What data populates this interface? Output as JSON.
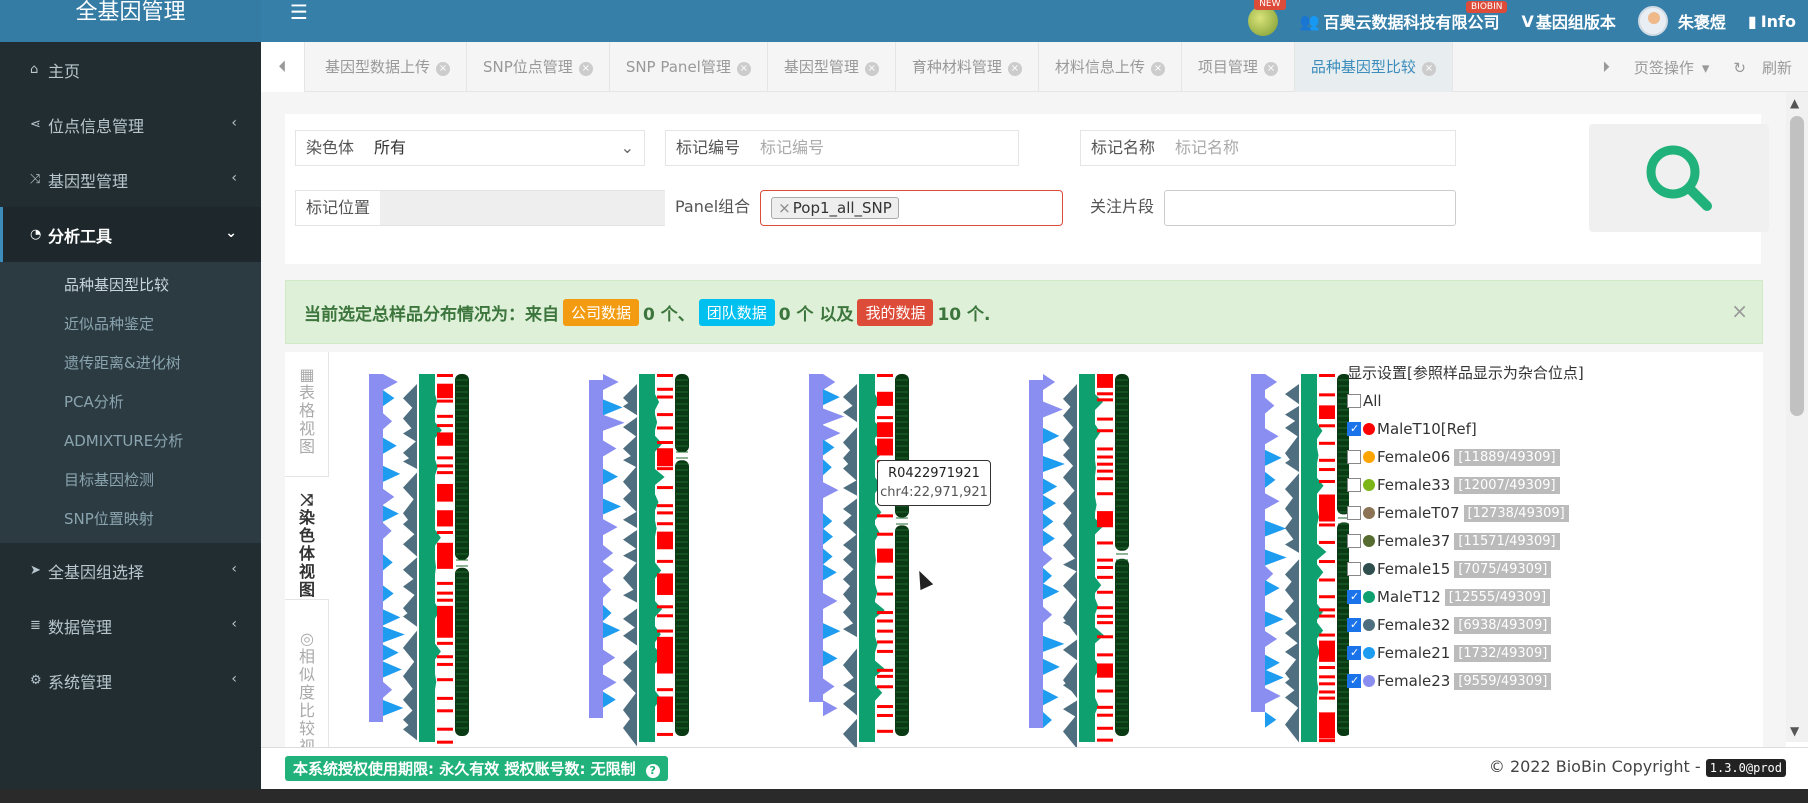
{
  "brand": {
    "title": "全基因管理"
  },
  "topbar": {
    "new_badge": "NEW",
    "company": "百奥云数据科技有限公司",
    "company_badge": "BIOBIN",
    "version": "基因组版本",
    "user": "朱褒煜",
    "info": "Info"
  },
  "sidebar": {
    "items": [
      {
        "label": "主页",
        "icon": "home-icon"
      },
      {
        "label": "位点信息管理",
        "icon": "share-icon"
      },
      {
        "label": "基因型管理",
        "icon": "random-icon"
      },
      {
        "label": "分析工具",
        "icon": "pie-chart-icon"
      },
      {
        "label": "全基因组选择",
        "icon": "paper-plane-icon"
      },
      {
        "label": "数据管理",
        "icon": "database-icon"
      },
      {
        "label": "系统管理",
        "icon": "gear-icon"
      }
    ],
    "analysis_sub": [
      "品种基因型比较",
      "近似品种鉴定",
      "遗传距离&进化树",
      "PCA分析",
      "ADMIXTURE分析",
      "目标基因检测",
      "SNP位置映射"
    ]
  },
  "tabs": {
    "items": [
      "基因型数据上传",
      "SNP位点管理",
      "SNP Panel管理",
      "基因型管理",
      "育种材料管理",
      "材料信息上传",
      "项目管理",
      "品种基因型比较"
    ],
    "page_ops": "页签操作",
    "refresh": "刷新"
  },
  "filters": {
    "chromosome_label": "染色体",
    "chromosome_value": "所有",
    "marker_id_label": "标记编号",
    "marker_id_placeholder": "标记编号",
    "marker_name_label": "标记名称",
    "marker_name_placeholder": "标记名称",
    "marker_pos_label": "标记位置",
    "panel_label": "Panel组合",
    "panel_tag": "Pop1_all_SNP",
    "focus_label": "关注片段"
  },
  "alert": {
    "prefix": "当前选定总样品分布情况为：来自",
    "company_label": "公司数据",
    "company_count": "0 个、",
    "team_label": "团队数据",
    "team_count": "0 个 以及",
    "mine_label": "我的数据",
    "mine_count": "10 个."
  },
  "view_tabs": [
    {
      "label": "表格视图",
      "icon": "table-icon"
    },
    {
      "label": "染色体视图",
      "icon": "random-icon"
    },
    {
      "label": "相似度比较视图",
      "icon": "chrome-icon"
    }
  ],
  "legend": {
    "header": "显示设置[参照样品显示为杂合位点]",
    "all_label": "All",
    "samples": [
      {
        "name": "MaleT10[Ref]",
        "color": "#ff0000",
        "checked": true,
        "count": ""
      },
      {
        "name": "Female06",
        "color": "#ffa500",
        "checked": false,
        "count": "[11889/49309]"
      },
      {
        "name": "Female33",
        "color": "#7cb518",
        "checked": false,
        "count": "[12007/49309]"
      },
      {
        "name": "FemaleT07",
        "color": "#8b7355",
        "checked": false,
        "count": "[12738/49309]"
      },
      {
        "name": "Female37",
        "color": "#556b2f",
        "checked": false,
        "count": "[11571/49309]"
      },
      {
        "name": "Female15",
        "color": "#2f4f4f",
        "checked": false,
        "count": "[7075/49309]"
      },
      {
        "name": "MaleT12",
        "color": "#0fa070",
        "checked": true,
        "count": "[12555/49309]"
      },
      {
        "name": "Female32",
        "color": "#4f6f80",
        "checked": true,
        "count": "[6938/49309]"
      },
      {
        "name": "Female21",
        "color": "#1e9cf0",
        "checked": true,
        "count": "[1732/49309]"
      },
      {
        "name": "Female23",
        "color": "#8a8ef0",
        "checked": true,
        "count": "[9559/49309]"
      }
    ]
  },
  "tooltip": {
    "id": "R0422971921",
    "pos": "chr4:22,971,921"
  },
  "footer": {
    "license": "本系统授权使用期限: 永久有效 授权账号数: 无限制",
    "copyright": "© 2022 BioBin Copyright -",
    "version": "1.3.0@prod"
  }
}
